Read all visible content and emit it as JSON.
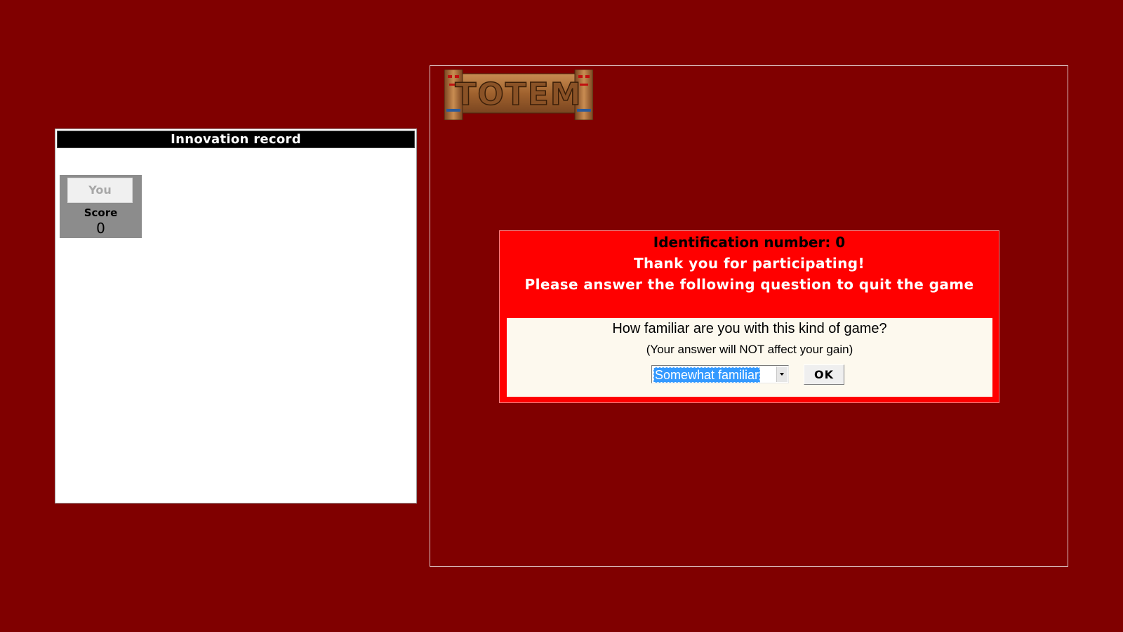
{
  "record_panel": {
    "title": "Innovation record",
    "player": {
      "name": "You",
      "score_label": "Score",
      "score_value": "0"
    }
  },
  "game_panel": {
    "logo_text": "TOTEM",
    "dialog": {
      "id_line": "Identification number: 0",
      "thanks_line": "Thank you for participating!",
      "instruction_line": "Please answer the following question to quit the game",
      "question": "How familiar are you with this kind of game?",
      "note": "(Your answer will NOT affect your gain)",
      "select_value": "Somewhat familiar",
      "ok_label": "OK"
    }
  },
  "colors": {
    "background": "#800000",
    "dialog_red": "#ff0000",
    "question_bg": "#fdf9ee",
    "selection_blue": "#3399ff",
    "player_card_gray": "#8c8c8c"
  },
  "icons": [
    "totem-logo-icon",
    "dropdown-arrow-icon"
  ]
}
